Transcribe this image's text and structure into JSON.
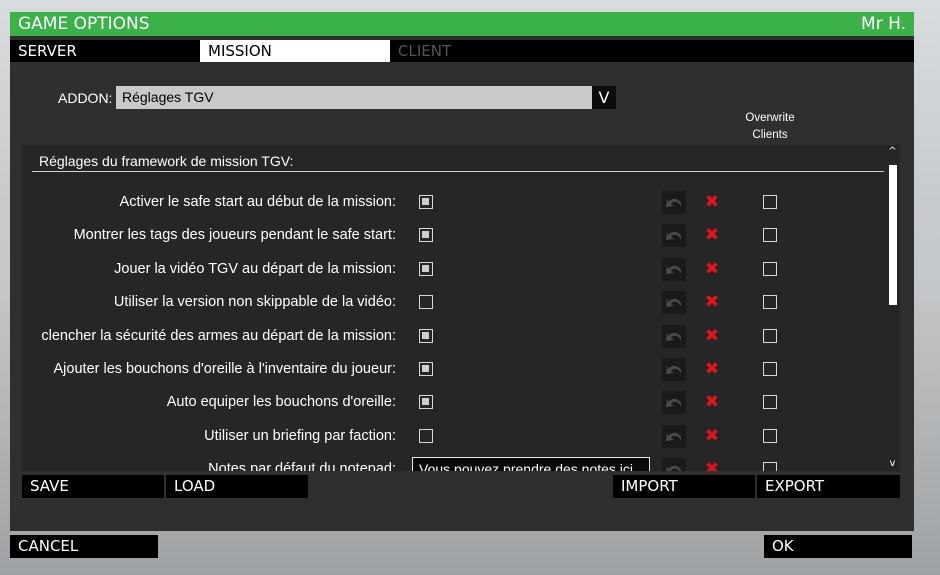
{
  "window": {
    "title": "GAME OPTIONS",
    "user": "Mr H."
  },
  "tabs": [
    {
      "label": "SERVER",
      "state": "normal"
    },
    {
      "label": "MISSION",
      "state": "active"
    },
    {
      "label": "CLIENT",
      "state": "disabled"
    }
  ],
  "addon": {
    "label": "ADDON:",
    "selected": "Réglages TGV",
    "arrow": "V"
  },
  "overwrite_header": {
    "line1": "Overwrite",
    "line2": "Clients"
  },
  "panel": {
    "title": "Réglages du framework de mission TGV:",
    "rows": [
      {
        "label": "Activer le safe start au début de la mission:",
        "type": "checkbox",
        "checked": true,
        "overwrite": false
      },
      {
        "label": "Montrer les tags des joueurs pendant le safe start:",
        "type": "checkbox",
        "checked": true,
        "overwrite": false
      },
      {
        "label": "Jouer la vidéo TGV au départ de la mission:",
        "type": "checkbox",
        "checked": true,
        "overwrite": false
      },
      {
        "label": "Utiliser la version non skippable de la vidéo:",
        "type": "checkbox",
        "checked": false,
        "overwrite": false
      },
      {
        "label": "clencher la sécurité des armes au départ de la mission:",
        "type": "checkbox",
        "checked": true,
        "overwrite": false
      },
      {
        "label": "Ajouter les bouchons d'oreille à l'inventaire du joueur:",
        "type": "checkbox",
        "checked": true,
        "overwrite": false
      },
      {
        "label": "Auto equiper les bouchons d'oreille:",
        "type": "checkbox",
        "checked": true,
        "overwrite": false
      },
      {
        "label": "Utiliser un briefing par faction:",
        "type": "checkbox",
        "checked": false,
        "overwrite": false
      },
      {
        "label": "Notes par défaut du notepad:",
        "type": "text",
        "value": "Vous pouvez prendre des notes ici.",
        "overwrite": false
      }
    ],
    "reset_icon": "undo-icon",
    "clear_icon": "x-icon",
    "scroll_up": "^",
    "scroll_down": "v"
  },
  "buttons": {
    "save": "SAVE",
    "load": "LOAD",
    "import": "IMPORT",
    "export": "EXPORT",
    "cancel": "CANCEL",
    "ok": "OK"
  },
  "colors": {
    "title_bar": "#3bb14a",
    "clear_x": "#e0141a"
  }
}
